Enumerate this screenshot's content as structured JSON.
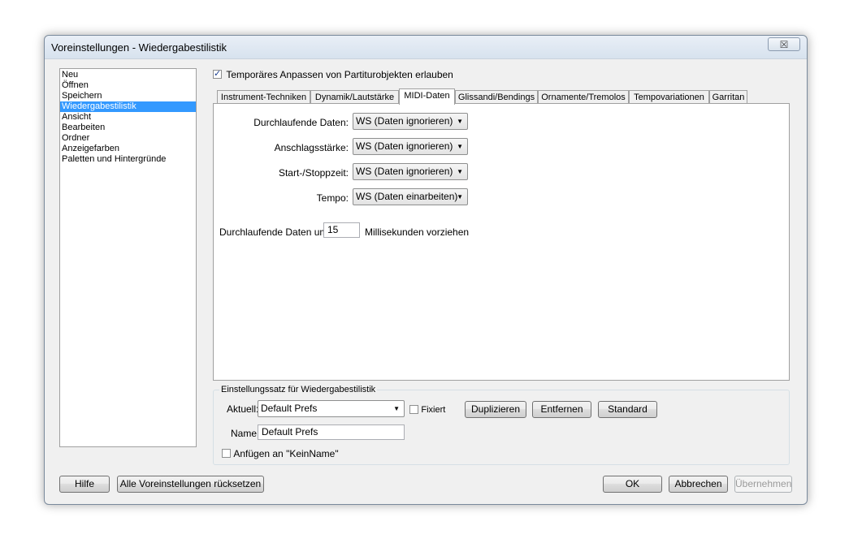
{
  "window": {
    "title": "Voreinstellungen - Wiedergabestilistik",
    "close_symbol": "☒"
  },
  "sidebar": {
    "items": [
      {
        "label": "Neu"
      },
      {
        "label": "Öffnen"
      },
      {
        "label": "Speichern"
      },
      {
        "label": "Wiedergabestilistik",
        "selected": true
      },
      {
        "label": "Ansicht"
      },
      {
        "label": "Bearbeiten"
      },
      {
        "label": "Ordner"
      },
      {
        "label": "Anzeigefarben"
      },
      {
        "label": "Paletten und Hintergründe"
      }
    ]
  },
  "top_checkbox": {
    "label": "Temporäres Anpassen von Partiturobjekten erlauben",
    "checked": true
  },
  "tabs": [
    {
      "label": "Instrument-Techniken"
    },
    {
      "label": "Dynamik/Lautstärke"
    },
    {
      "label": "MIDI-Daten",
      "active": true
    },
    {
      "label": "Glissandi/Bendings"
    },
    {
      "label": "Ornamente/Tremolos"
    },
    {
      "label": "Tempovariationen"
    },
    {
      "label": "Garritan"
    }
  ],
  "midi": {
    "rows": [
      {
        "label": "Durchlaufende Daten:",
        "value": "WS (Daten ignorieren)"
      },
      {
        "label": "Anschlagsstärke:",
        "value": "WS (Daten ignorieren)"
      },
      {
        "label": "Start-/Stoppzeit:",
        "value": "WS (Daten ignorieren)"
      },
      {
        "label": "Tempo:",
        "value": "WS (Daten einarbeiten)"
      }
    ],
    "advance_label": "Durchlaufende Daten um:",
    "advance_value": "15",
    "advance_unit": "Millisekunden vorziehen"
  },
  "preset_group": {
    "title": "Einstellungssatz für Wiedergabestilistik",
    "current_label": "Aktuell:",
    "current_value": "Default Prefs",
    "fixed_label": "Fixiert",
    "fixed_checked": false,
    "duplicate_label": "Duplizieren",
    "remove_label": "Entfernen",
    "default_label": "Standard",
    "name_label": "Name:",
    "name_value": "Default Prefs",
    "append_label": "Anfügen an \"KeinName\"",
    "append_checked": false
  },
  "footer": {
    "help_label": "Hilfe",
    "reset_label": "Alle Voreinstellungen rücksetzen",
    "ok_label": "OK",
    "cancel_label": "Abbrechen",
    "apply_label": "Übernehmen"
  },
  "colors": {
    "selection": "#3399ff",
    "dialog_bg": "#f0f0f0",
    "disabled_text": "#9a9a9a"
  }
}
